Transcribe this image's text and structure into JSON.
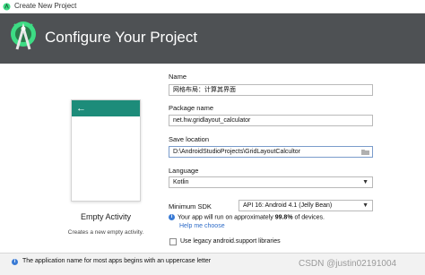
{
  "window": {
    "title": "Create New Project"
  },
  "header": {
    "title": "Configure Your Project"
  },
  "template": {
    "name": "Empty Activity",
    "description": "Creates a new empty activity.",
    "appbar_color": "#1d8c7a"
  },
  "form": {
    "name_label": "Name",
    "name_value": "网格布局：计算其界面",
    "package_label": "Package name",
    "package_value": "net.hw.gridlayout_calculator",
    "save_label": "Save location",
    "save_value": "D:\\AndroidStudioProjects\\GridLayoutCalcultor",
    "language_label": "Language",
    "language_value": "Kotlin",
    "min_sdk_label": "Minimum SDK",
    "min_sdk_value": "API 16: Android 4.1 (Jelly Bean)",
    "sdk_info_prefix": "Your app will run on approximately ",
    "sdk_info_percent": "99.8%",
    "sdk_info_suffix": " of devices.",
    "help_link": "Help me choose",
    "legacy_label": "Use legacy android.support libraries",
    "legacy_checked": false
  },
  "footer": {
    "message": "The application name for most apps begins with an uppercase letter"
  },
  "watermark": "CSDN @justin02191004",
  "colors": {
    "header_bg": "#4e5154",
    "android_green": "#3ddc84",
    "link": "#2d6bc7"
  }
}
